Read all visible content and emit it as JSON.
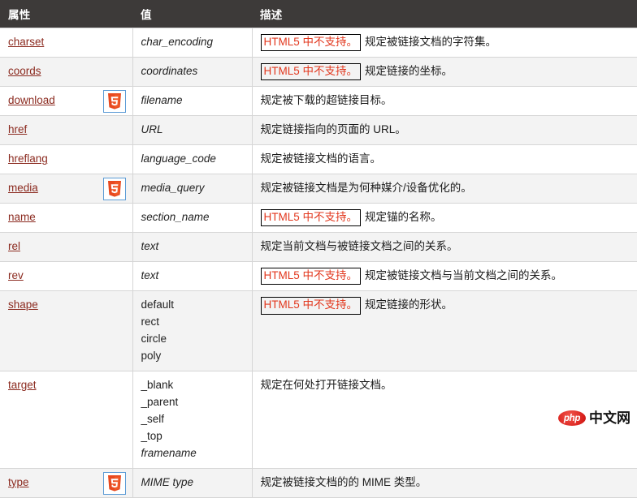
{
  "table": {
    "headers": [
      "属性",
      "值",
      "描述"
    ],
    "not_supported_label": "HTML5 中不支持。",
    "html5_icon_name": "html5-badge-icon",
    "rows": [
      {
        "attr": "charset",
        "html5": false,
        "value": "char_encoding",
        "value_style": "italic",
        "not_supported": true,
        "desc": "规定被链接文档的字符集。"
      },
      {
        "attr": "coords",
        "html5": false,
        "value": "coordinates",
        "value_style": "italic",
        "not_supported": true,
        "desc": "规定链接的坐标。"
      },
      {
        "attr": "download",
        "html5": true,
        "value": "filename",
        "value_style": "italic",
        "not_supported": false,
        "desc": "规定被下载的超链接目标。"
      },
      {
        "attr": "href",
        "html5": false,
        "value": "URL",
        "value_style": "italic",
        "not_supported": false,
        "desc": "规定链接指向的页面的 URL。"
      },
      {
        "attr": "hreflang",
        "html5": false,
        "value": "language_code",
        "value_style": "italic",
        "not_supported": false,
        "desc": "规定被链接文档的语言。"
      },
      {
        "attr": "media",
        "html5": true,
        "value": "media_query",
        "value_style": "italic",
        "not_supported": false,
        "desc": "规定被链接文档是为何种媒介/设备优化的。"
      },
      {
        "attr": "name",
        "html5": false,
        "value": "section_name",
        "value_style": "italic",
        "not_supported": true,
        "desc": "规定锚的名称。"
      },
      {
        "attr": "rel",
        "html5": false,
        "value": "text",
        "value_style": "italic",
        "not_supported": false,
        "desc": "规定当前文档与被链接文档之间的关系。"
      },
      {
        "attr": "rev",
        "html5": false,
        "value": "text",
        "value_style": "italic",
        "not_supported": true,
        "desc": "规定被链接文档与当前文档之间的关系。"
      },
      {
        "attr": "shape",
        "html5": false,
        "value": "default\nrect\ncircle\npoly",
        "value_style": "plain",
        "not_supported": true,
        "desc": "规定链接的形状。"
      },
      {
        "attr": "target",
        "html5": false,
        "value": "_blank\n_parent\n_self\n_top",
        "value_style": "plain",
        "value_italic_tail": "framename",
        "not_supported": false,
        "desc": "规定在何处打开链接文档。"
      },
      {
        "attr": "type",
        "html5": true,
        "value": "MIME type",
        "value_style": "italic",
        "not_supported": false,
        "desc": "规定被链接文档的的 MIME 类型。"
      }
    ]
  },
  "watermark": {
    "php_text": "php",
    "site_text": "中文网"
  },
  "colors": {
    "header_bg": "#3d3a39",
    "link": "#8b2a1f",
    "not_supported_text": "#e2371d",
    "badge_border": "#5b9bd5",
    "row_alt_bg": "#f3f3f3",
    "watermark_red": "#d9201c"
  }
}
